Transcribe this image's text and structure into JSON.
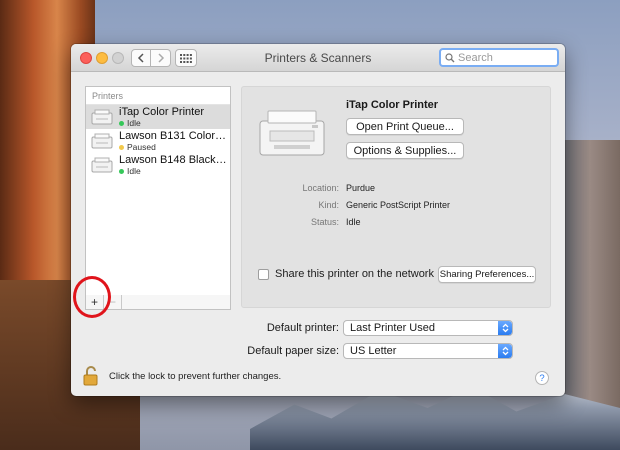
{
  "window": {
    "title": "Printers & Scanners"
  },
  "search": {
    "placeholder": "Search"
  },
  "printers": {
    "header": "Printers",
    "items": [
      {
        "name": "iTap Color Printer",
        "status": "Idle",
        "status_color": "#35c759",
        "selected": true
      },
      {
        "name": "Lawson B131 Color Pri...",
        "status": "Paused",
        "status_color": "#f2c94c",
        "selected": false
      },
      {
        "name": "Lawson B148 Black an...",
        "status": "Idle",
        "status_color": "#35c759",
        "selected": false
      }
    ],
    "add_glyph": "+",
    "remove_glyph": "−"
  },
  "detail": {
    "name": "iTap Color Printer",
    "open_queue_label": "Open Print Queue...",
    "options_label": "Options & Supplies...",
    "location_label": "Location:",
    "location_value": "Purdue",
    "kind_label": "Kind:",
    "kind_value": "Generic PostScript Printer",
    "status_label": "Status:",
    "status_value": "Idle",
    "share_label": "Share this printer on the network",
    "share_checked": false,
    "sharing_prefs_label": "Sharing Preferences..."
  },
  "defaults": {
    "printer_label": "Default printer:",
    "printer_value": "Last Printer Used",
    "paper_label": "Default paper size:",
    "paper_value": "US Letter"
  },
  "lock": {
    "text": "Click the lock to prevent further changes."
  },
  "help": {
    "glyph": "?"
  },
  "colors": {
    "accent": "#2b7cf0",
    "annotation_circle": "#e0141b"
  }
}
